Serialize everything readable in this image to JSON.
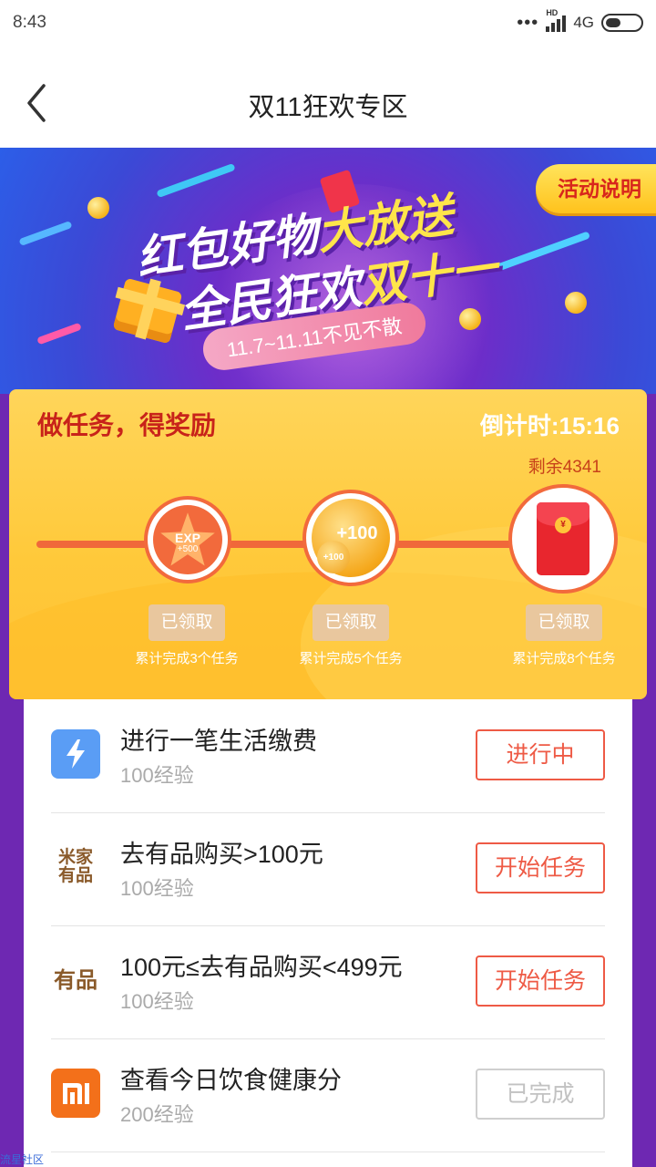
{
  "status_bar": {
    "time": "8:43",
    "network": "4G",
    "hd": "HD"
  },
  "nav": {
    "title": "双11狂欢专区"
  },
  "banner": {
    "line1_white": "红包好物",
    "line1_yellow": "大放送",
    "line2_white": "全民狂欢",
    "line2_yellow": "双十一",
    "date_range": "11.7~11.11不见不散",
    "activity_button": "活动说明"
  },
  "reward": {
    "title": "做任务，得奖励",
    "countdown": "倒计时:15:16",
    "remaining": "剩余4341",
    "milestones": [
      {
        "icon": "exp-star-icon",
        "icon_line1": "EXP",
        "icon_line2": "+500",
        "button": "已领取",
        "caption": "累计完成3个任务"
      },
      {
        "icon": "coin-icon",
        "icon_line1": "+100",
        "icon_line2": "+100",
        "button": "已领取",
        "caption": "累计完成5个任务"
      },
      {
        "icon": "red-packet-icon",
        "icon_line1": "¥",
        "button": "已领取",
        "caption": "累计完成8个任务"
      }
    ]
  },
  "tasks": [
    {
      "icon": "bolt-icon",
      "title": "进行一笔生活缴费",
      "reward": "100经验",
      "button": "进行中",
      "state": "in-progress"
    },
    {
      "icon": "mijia-youpin-icon",
      "icon_text": [
        "米家",
        "有品"
      ],
      "title": "去有品购买>100元",
      "reward": "100经验",
      "button": "开始任务",
      "state": "start"
    },
    {
      "icon": "youpin-icon",
      "icon_text": [
        "有品"
      ],
      "title": "100元≤去有品购买<499元",
      "reward": "100经验",
      "button": "开始任务",
      "state": "start"
    },
    {
      "icon": "mi-logo-icon",
      "title": "查看今日饮食健康分",
      "reward": "200经验",
      "button": "已完成",
      "state": "done"
    }
  ],
  "watermark": "流星社区",
  "colors": {
    "accent_red": "#ee5a45",
    "banner_purple": "#6e28b2",
    "card_yellow": "#ffc93a",
    "done_gray": "#c2c2c2"
  }
}
